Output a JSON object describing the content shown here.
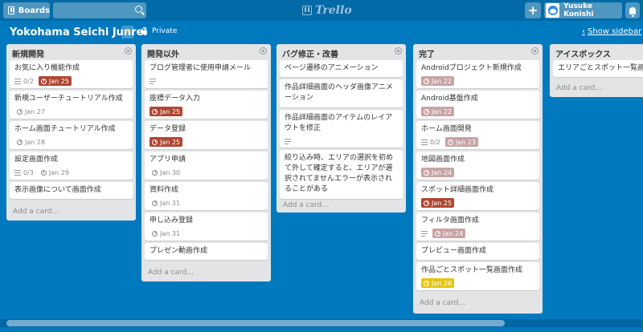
{
  "header": {
    "boards_label": "Boards",
    "search_value": "",
    "logo_text": "Trello",
    "add_symbol": "+",
    "user_name": "Yusuke Konishi"
  },
  "board": {
    "title": "Yokohama Seichi Junrei",
    "star_symbol": "☆",
    "visibility": "Private",
    "show_sidebar": "Show sidebar"
  },
  "add_card_label": "Add a card…",
  "lists": [
    {
      "title": "新規開発",
      "cards": [
        {
          "title": "お気に入り機能作成",
          "check": "0/2",
          "due": "Jan 25"
        },
        {
          "title": "新規ユーザーチュートリアル作成",
          "due": "Jan 27"
        },
        {
          "title": "ホーム画面チュートリアル作成",
          "due": "Jan 28"
        },
        {
          "title": "設定画面作成",
          "check": "0/3",
          "due": "Jan 29"
        },
        {
          "title": "表示画像について画面作成"
        }
      ]
    },
    {
      "title": "開発以外",
      "cards": [
        {
          "title": "ブログ管理者に使用申請メール"
        },
        {
          "title": "座標データ入力",
          "due": "Jan 25"
        },
        {
          "title": "データ登録",
          "due": "Jan 25"
        },
        {
          "title": "アプリ申請",
          "due": "Jan 30"
        },
        {
          "title": "資料作成",
          "due": "Jan 31"
        },
        {
          "title": "申し込み登録",
          "due": "Jan 31"
        },
        {
          "title": "プレゼン動画作成"
        }
      ]
    },
    {
      "title": "バグ修正・改善",
      "cards": [
        {
          "title": "ページ遷移のアニメーション"
        },
        {
          "title": "作品詳細画面のヘッダ画像アニメーション"
        },
        {
          "title": "作品詳細画面のアイテムのレイアウトを修正"
        },
        {
          "title": "絞り込み時、エリアの選択を初めて外して確定すると、エリアが選択されてませんエラーが表示されることがある"
        }
      ]
    },
    {
      "title": "完了",
      "cards": [
        {
          "title": "Androidプロジェクト新規作成",
          "due": "Jan 22"
        },
        {
          "title": "Android基盤作成",
          "due": "Jan 22"
        },
        {
          "title": "ホーム画面開発",
          "check": "0/2",
          "due": "Jan 23"
        },
        {
          "title": "地図画面作成",
          "due": "Jan 24"
        },
        {
          "title": "スポット詳細画面作成",
          "due": "Jan 25"
        },
        {
          "title": "フィルタ画面作成",
          "due": "Jan 24"
        },
        {
          "title": "プレビュー画面作成"
        },
        {
          "title": "作品ごとスポット一覧画面作成",
          "due": "Jan 26"
        }
      ]
    },
    {
      "title": "アイスボックス",
      "cards": [
        {
          "title": "エリアごとスポット一覧画面"
        }
      ]
    }
  ],
  "colors": {
    "background": "#0079bf",
    "header": "#026aa7",
    "due_overdue": "#b04632",
    "due_past_complete": "#c9a3a3",
    "due_soon": "#e6c60d",
    "star": "#f2d600"
  },
  "icons": [
    "boards-icon",
    "search-icon",
    "trello-logo-icon",
    "plus-icon",
    "avatar",
    "bell-icon",
    "star-icon",
    "lock-icon",
    "chevron-left-icon",
    "list-menu-icon",
    "checklist-icon",
    "clock-icon",
    "description-icon"
  ]
}
